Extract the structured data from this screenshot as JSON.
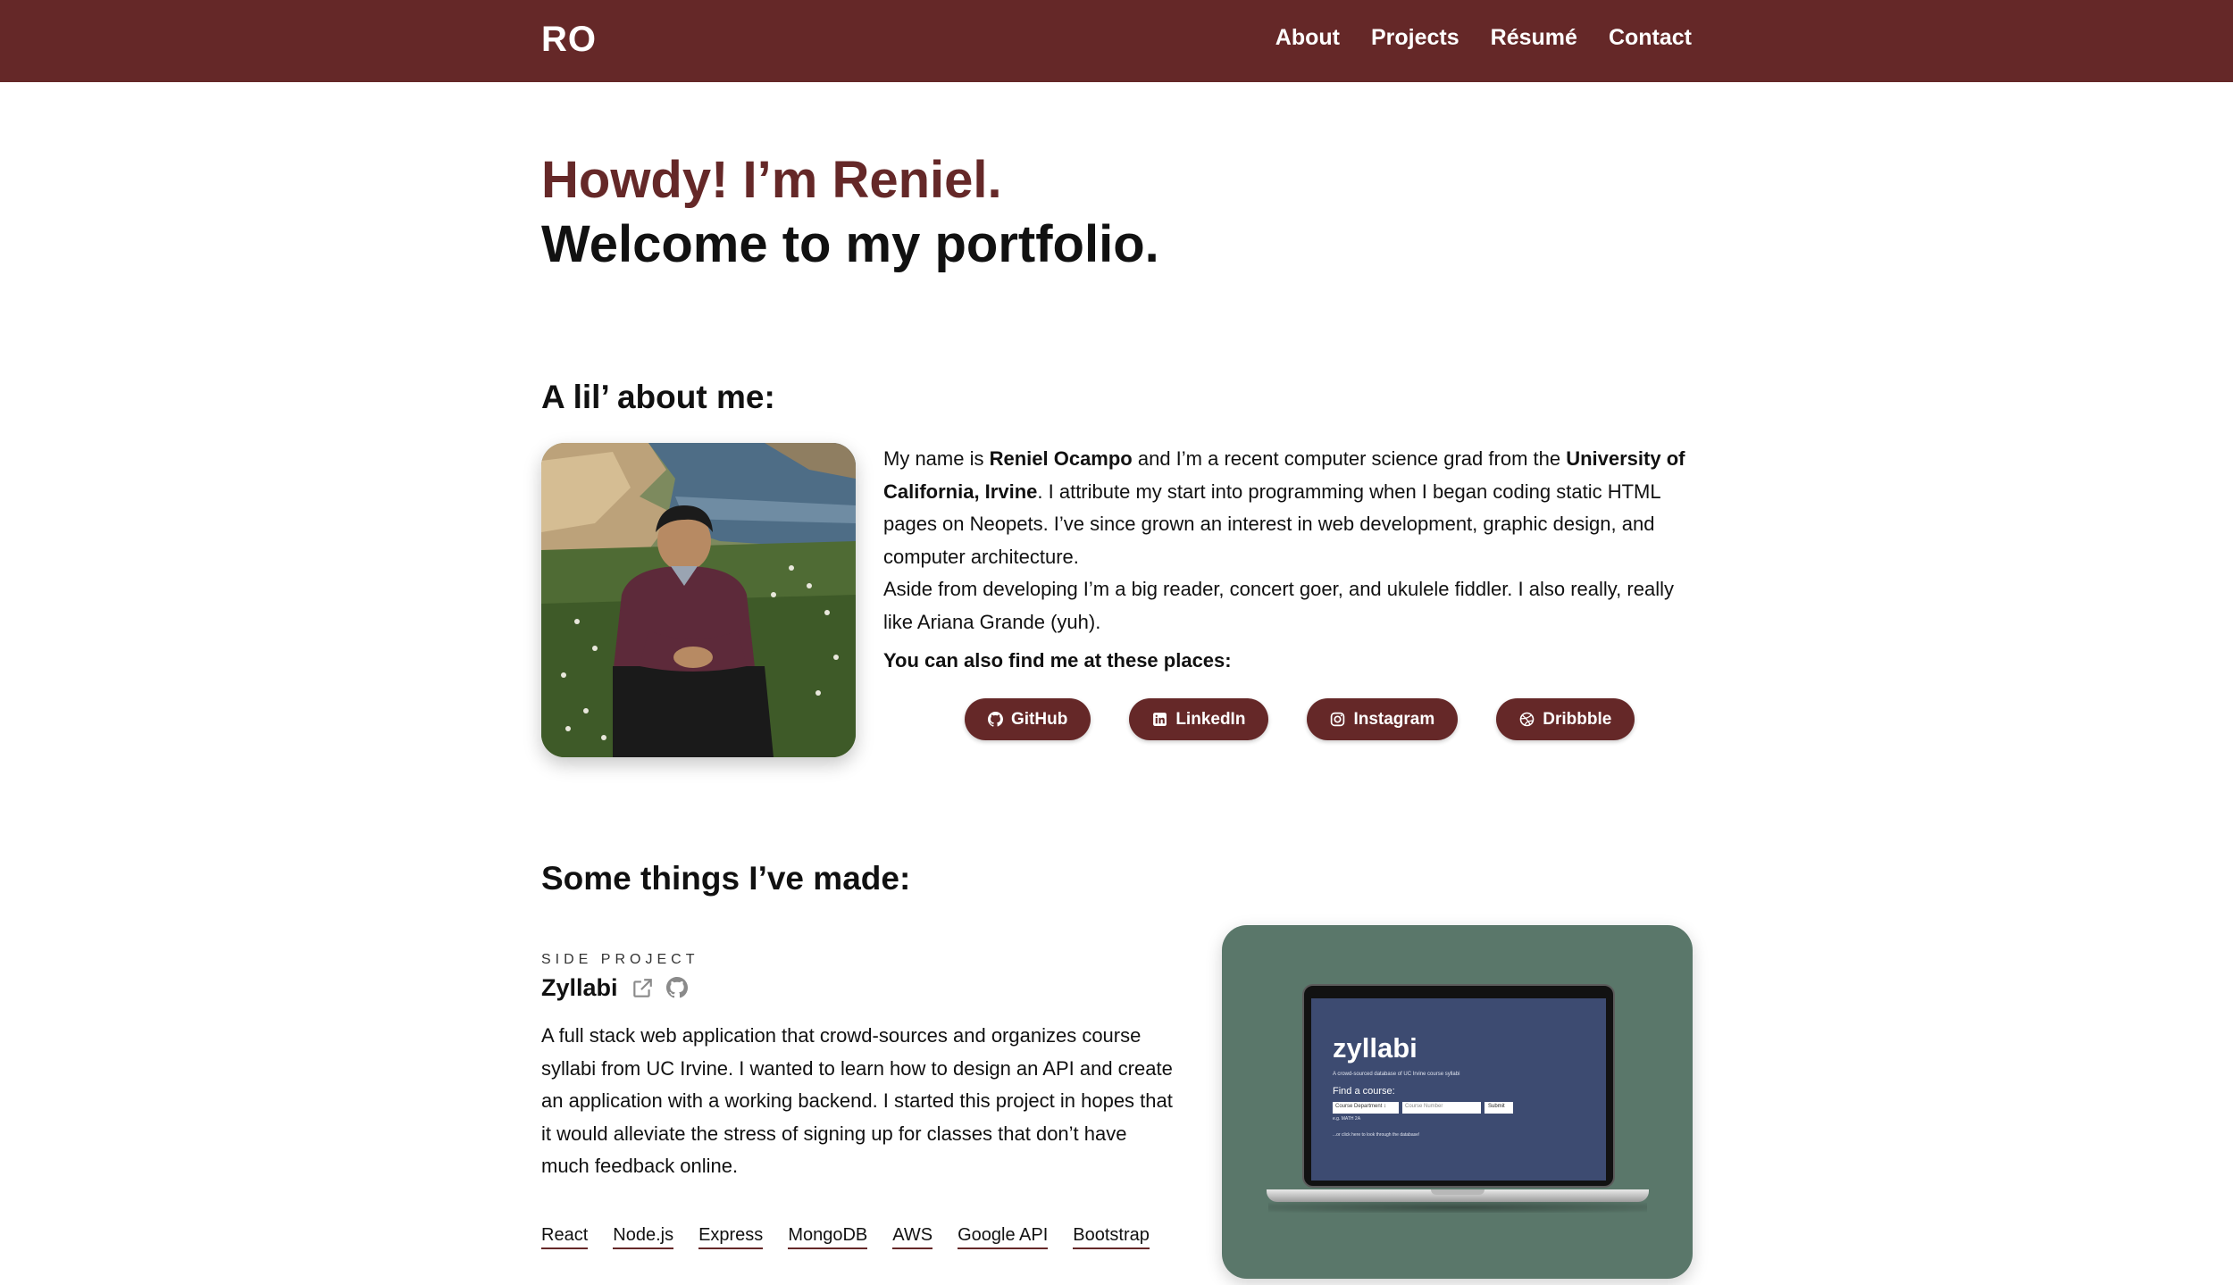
{
  "nav": {
    "brand": "RO",
    "links": [
      "About",
      "Projects",
      "Résumé",
      "Contact"
    ]
  },
  "hero": {
    "line1": "Howdy! I’m Reniel.",
    "line2": "Welcome to my portfolio."
  },
  "about": {
    "title": "A lil’ about me:",
    "bio_p1_a": "My name is ",
    "bio_p1_name": "Reniel Ocampo",
    "bio_p1_b": " and I’m a recent computer science grad from the ",
    "bio_p1_school": "University of California, Irvine",
    "bio_p1_c": ". I attribute my start into programming when I began coding static HTML pages on Neopets. I’ve since grown an interest in web development, graphic design, and computer architecture.",
    "bio_p2": "Aside from developing I’m a big reader, concert goer, and ukulele fiddler. I also really, really like Ariana Grande (yuh).",
    "find_me": "You can also find me at these places:",
    "socials": [
      {
        "label": "GitHub",
        "icon": "github-icon"
      },
      {
        "label": "LinkedIn",
        "icon": "linkedin-icon"
      },
      {
        "label": "Instagram",
        "icon": "instagram-icon"
      },
      {
        "label": "Dribbble",
        "icon": "dribbble-icon"
      }
    ]
  },
  "projects": {
    "title": "Some things I’ve made:",
    "items": [
      {
        "eyebrow": "SIDE PROJECT",
        "name": "Zyllabi",
        "description": "A full stack web application that crowd-sources and organizes course syllabi from UC Irvine. I wanted to learn how to design an API and create an application with a working backend. I started this project in hopes that it would alleviate the stress of signing up for classes that don’t have much feedback online.",
        "tags": [
          "React",
          "Node.js",
          "Express",
          "MongoDB",
          "AWS",
          "Google API",
          "Bootstrap"
        ],
        "preview": {
          "logo": "zyllabi",
          "subtitle": "A crowd-sourced database of UC Irvine course syllabi",
          "find_label": "Find a course:",
          "select_value": "Course Department ↕",
          "input_placeholder": "Course Number",
          "submit_label": "Submit",
          "example": "e.g. MATH 2A",
          "click_text": "...or click here to look through the database!"
        }
      }
    ]
  },
  "colors": {
    "brand": "#652828",
    "card": "#5a776a",
    "screen": "#3d4b71"
  }
}
